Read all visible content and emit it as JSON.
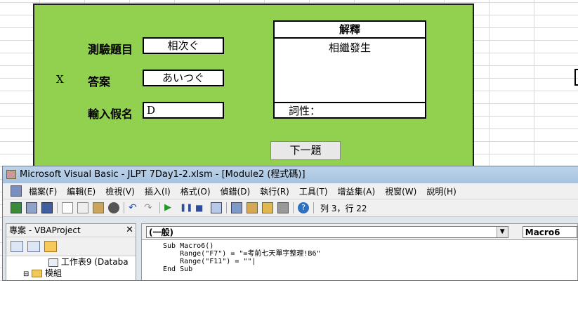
{
  "form": {
    "quiz_label": "測驗題目",
    "quiz_value": "相次ぐ",
    "answer_mark": "X",
    "answer_label": "答案",
    "answer_value": "あいつぐ",
    "input_label": "輸入假名",
    "input_value": "D",
    "explanation_title": "解釋",
    "explanation_body": "相繼發生",
    "pos_label": "詞性：",
    "next_button": "下一題"
  },
  "vba": {
    "title": "Microsoft Visual Basic - JLPT 7Day1-2.xlsm - [Module2 (程式碼)]",
    "menu": [
      "檔案(F)",
      "編輯(E)",
      "檢視(V)",
      "插入(I)",
      "格式(O)",
      "偵錯(D)",
      "執行(R)",
      "工具(T)",
      "增益集(A)",
      "視窗(W)",
      "說明(H)"
    ],
    "cursor_pos": "列 3，行 22",
    "project_title": "專案 - VBAProject",
    "tree": [
      "工作表9 (Databa",
      "模組"
    ],
    "object_combo": "(一般)",
    "proc_combo": "Macro6",
    "code_lines": [
      "Sub Macro6()",
      "    Range(\"F7\") = \"=考前七天單字整理!B6\"",
      "    Range(\"F11\") = \"\"|",
      "End Sub"
    ]
  },
  "colors": {
    "panel_green": "#92d050",
    "vba_title_bg": "#bcd4ea"
  }
}
